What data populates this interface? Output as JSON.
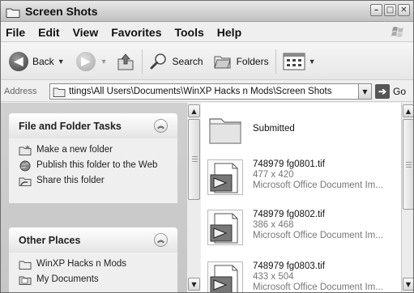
{
  "window": {
    "title": "Screen Shots"
  },
  "menu": [
    "File",
    "Edit",
    "View",
    "Favorites",
    "Tools",
    "Help"
  ],
  "toolbar": {
    "back_label": "Back",
    "search_label": "Search",
    "folders_label": "Folders"
  },
  "address": {
    "label": "Address",
    "value": "ttings\\All Users\\Documents\\WinXP Hacks n Mods\\Screen Shots",
    "go_label": "Go"
  },
  "file_tasks": {
    "title": "File and Folder Tasks",
    "items": [
      {
        "label": "Make a new folder",
        "icon": "new-folder-icon"
      },
      {
        "label": "Publish this folder to the Web",
        "icon": "globe-icon"
      },
      {
        "label": "Share this folder",
        "icon": "share-folder-icon"
      }
    ]
  },
  "other_places": {
    "title": "Other Places",
    "items": [
      {
        "label": "WinXP Hacks n Mods",
        "icon": "folder-icon"
      },
      {
        "label": "My Documents",
        "icon": "documents-icon"
      }
    ]
  },
  "files": [
    {
      "name": "Submitted",
      "type": "folder"
    },
    {
      "name": "748979 fg0801.tif",
      "dims": "477 x 420",
      "desc": "Microsoft Office Document Im..."
    },
    {
      "name": "748979 fg0802.tif",
      "dims": "386 x 468",
      "desc": "Microsoft Office Document Im..."
    },
    {
      "name": "748979 fg0803.tif",
      "dims": "433 x 504",
      "desc": "Microsoft Office Document Im..."
    }
  ]
}
